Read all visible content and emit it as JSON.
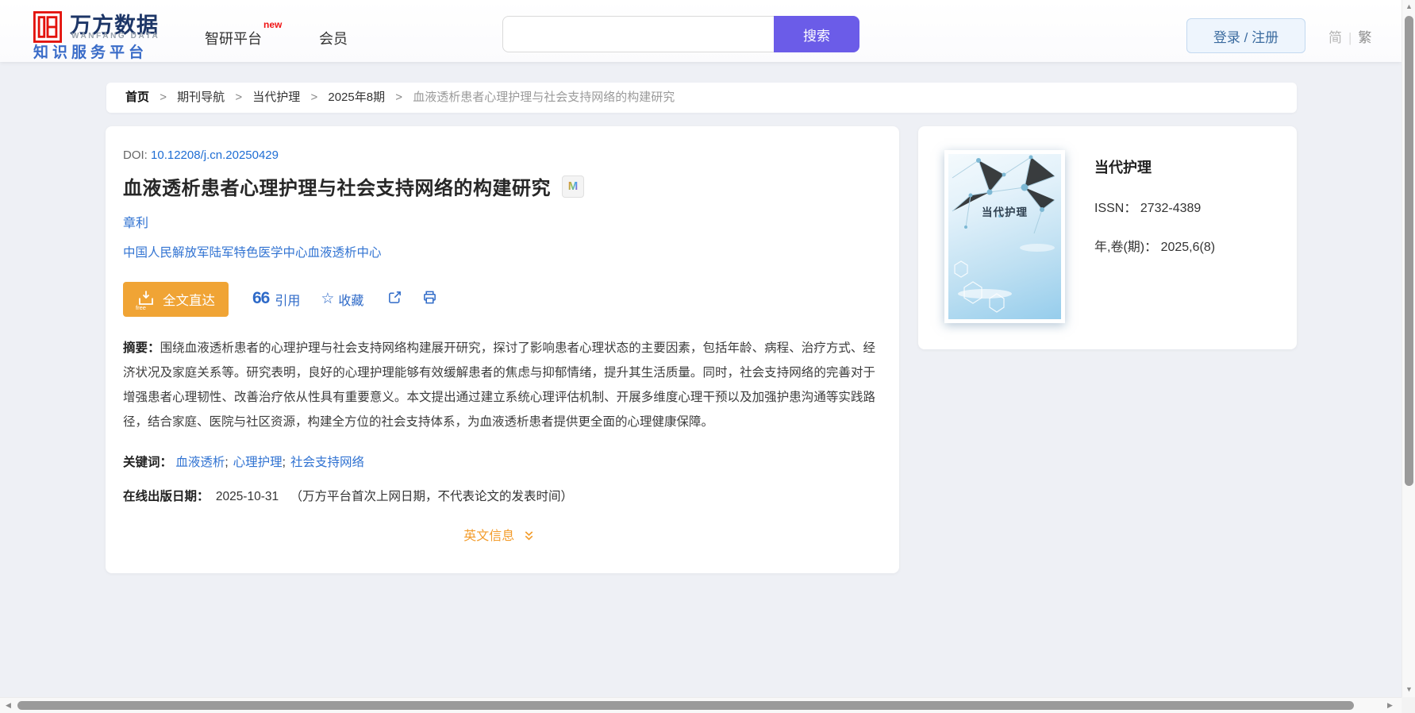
{
  "header": {
    "logo": {
      "brand_cn": "万方数据",
      "brand_en": "WANFANG DATA",
      "tagline": "知识服务平台"
    },
    "nav": [
      {
        "label": "智研平台",
        "badge": "new"
      },
      {
        "label": "会员"
      }
    ],
    "search": {
      "value": "",
      "placeholder": "",
      "button_label": "搜索"
    },
    "login_label": "登录 / 注册",
    "lang": {
      "simplified": "简",
      "divider": "|",
      "traditional": "繁"
    }
  },
  "breadcrumb": {
    "separator": ">",
    "items": [
      "首页",
      "期刊导航",
      "当代护理",
      "2025年8期"
    ],
    "current": "血液透析患者心理护理与社会支持网络的构建研究"
  },
  "article": {
    "doi_label": "DOI:",
    "doi": "10.12208/j.cn.20250429",
    "title": "血液透析患者心理护理与社会支持网络的构建研究",
    "badge": "M",
    "author": "章利",
    "affiliation": "中国人民解放军陆军特色医学中心血液透析中心",
    "actions": {
      "fulltext": "全文直达",
      "fulltext_icon_text": "free",
      "cite_mark": "66",
      "cite": "引用",
      "favorite": "收藏"
    },
    "abstract_label": "摘要：",
    "abstract": "围绕血液透析患者的心理护理与社会支持网络构建展开研究，探讨了影响患者心理状态的主要因素，包括年龄、病程、治疗方式、经济状况及家庭关系等。研究表明，良好的心理护理能够有效缓解患者的焦虑与抑郁情绪，提升其生活质量。同时，社会支持网络的完善对于增强患者心理韧性、改善治疗依从性具有重要意义。本文提出通过建立系统心理评估机制、开展多维度心理干预以及加强护患沟通等实践路径，结合家庭、医院与社区资源，构建全方位的社会支持体系，为血液透析患者提供更全面的心理健康保障。",
    "keywords_label": "关键词：",
    "keywords": [
      "血液透析",
      "心理护理",
      "社会支持网络"
    ],
    "keyword_separator": ";",
    "pubdate_label": "在线出版日期：",
    "pubdate": "2025-10-31",
    "pubdate_note": "（万方平台首次上网日期，不代表论文的发表时间）",
    "english_toggle": "英文信息"
  },
  "journal": {
    "cover_title": "当代护理",
    "name": "当代护理",
    "issn_label": "ISSN：",
    "issn": "2732-4389",
    "volume_label": "年,卷(期)：",
    "volume": "2025,6(8)"
  },
  "colors": {
    "brand_red": "#e3120b",
    "brand_navy": "#1d3667",
    "brand_blue": "#3a6cc8",
    "accent_purple": "#6b5ce8",
    "accent_orange": "#f0a435",
    "link_blue": "#2e6ac8",
    "english_orange": "#f39c2b"
  }
}
